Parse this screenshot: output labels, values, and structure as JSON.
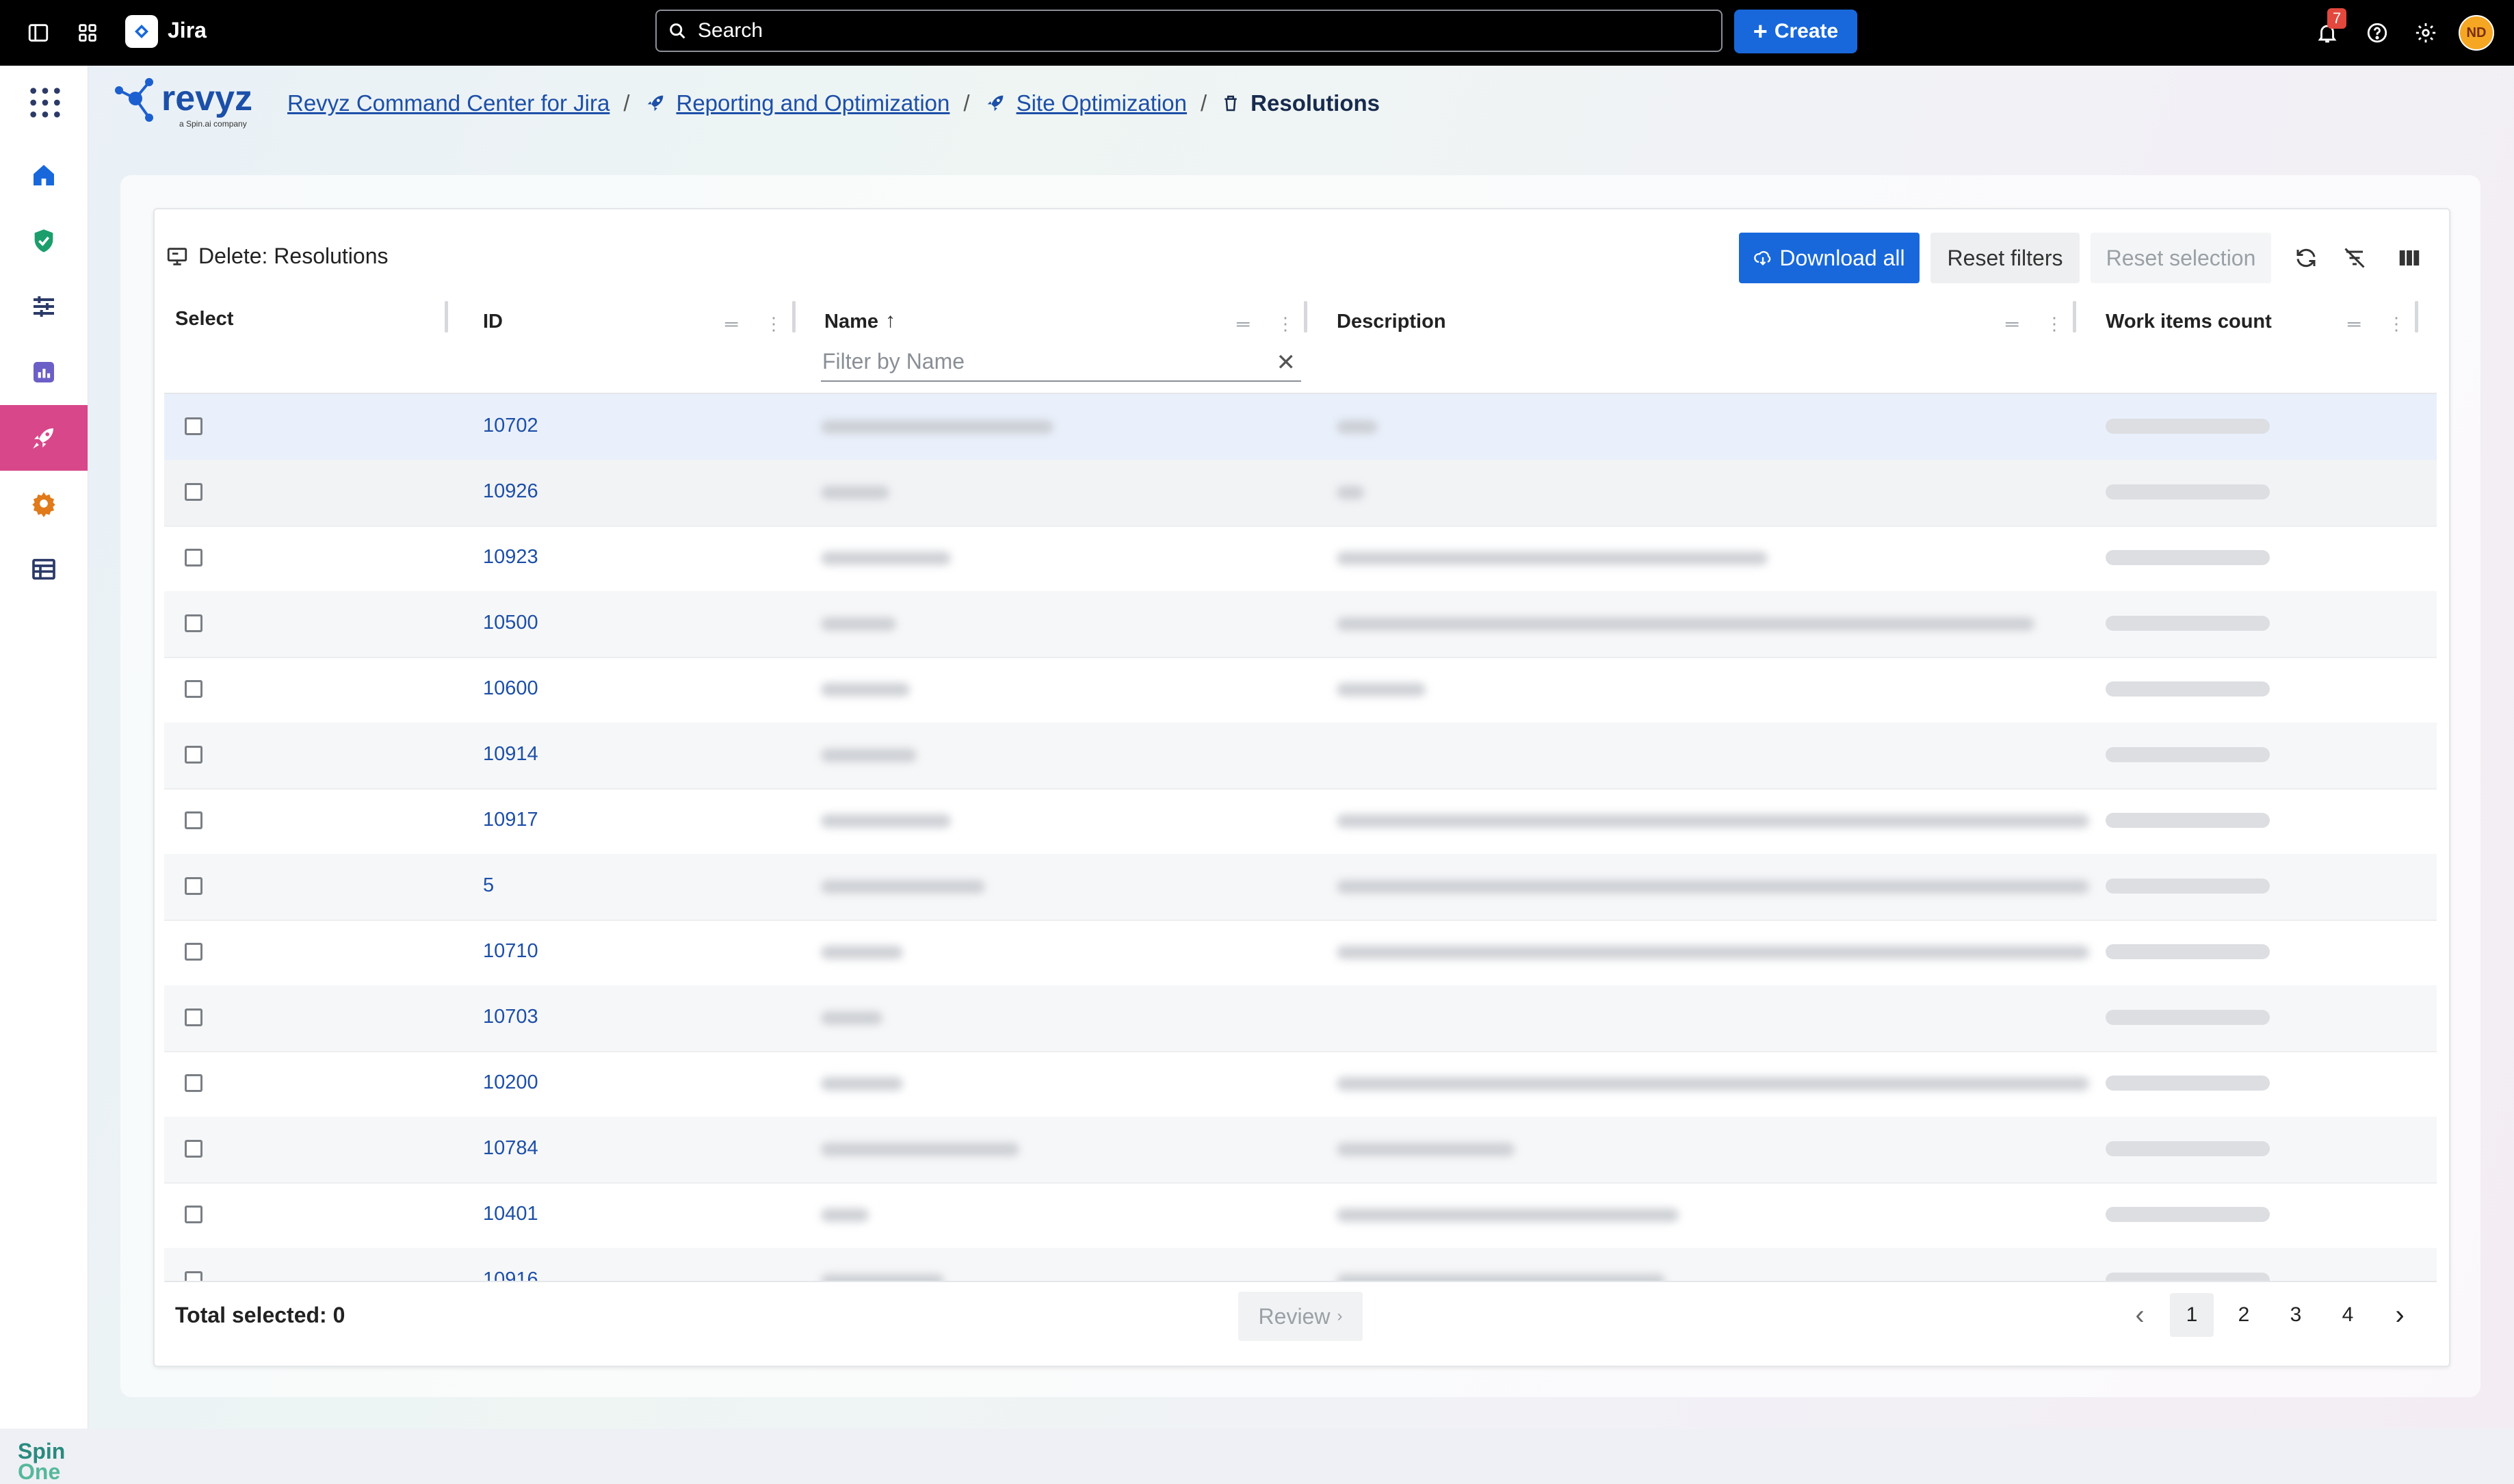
{
  "topbar": {
    "app_name": "Jira",
    "search_label": "Search",
    "create_label": "Create",
    "notification_count": "7",
    "avatar_initials": "ND"
  },
  "sidebar": {
    "items": [
      {
        "icon": "home-icon"
      },
      {
        "icon": "shield-check-icon"
      },
      {
        "icon": "sliders-icon"
      },
      {
        "icon": "report-chart-icon"
      },
      {
        "icon": "rocket-icon",
        "active": true
      },
      {
        "icon": "gear-icon"
      },
      {
        "icon": "table-icon"
      }
    ],
    "footer_brand_line1": "Spin",
    "footer_brand_line2": "One"
  },
  "brand": {
    "name": "revyz",
    "tagline": "a Spin.ai company"
  },
  "breadcrumb": {
    "items": [
      "Revyz Command Center for Jira",
      "Reporting and Optimization",
      "Site Optimization"
    ],
    "current": "Resolutions"
  },
  "panel": {
    "title": "Delete: Resolutions",
    "download_all": "Download all",
    "reset_filters": "Reset filters",
    "reset_selection": "Reset selection"
  },
  "table": {
    "columns": [
      "Select",
      "ID",
      "Name",
      "Description",
      "Work items count"
    ],
    "name_filter_placeholder": "Filter by Name",
    "rows": [
      {
        "id": "10702"
      },
      {
        "id": "10926"
      },
      {
        "id": "10923"
      },
      {
        "id": "10500"
      },
      {
        "id": "10600"
      },
      {
        "id": "10914"
      },
      {
        "id": "10917"
      },
      {
        "id": "5"
      },
      {
        "id": "10710"
      },
      {
        "id": "10703"
      },
      {
        "id": "10200"
      },
      {
        "id": "10784"
      },
      {
        "id": "10401"
      },
      {
        "id": "10916"
      }
    ]
  },
  "footer": {
    "total_selected": "Total selected: 0",
    "review": "Review",
    "pages": [
      "1",
      "2",
      "3",
      "4"
    ],
    "current_page": "1"
  },
  "colors": {
    "accent": "#1868db",
    "sidebar_active": "#d8478a",
    "link": "#1d4fa8"
  }
}
